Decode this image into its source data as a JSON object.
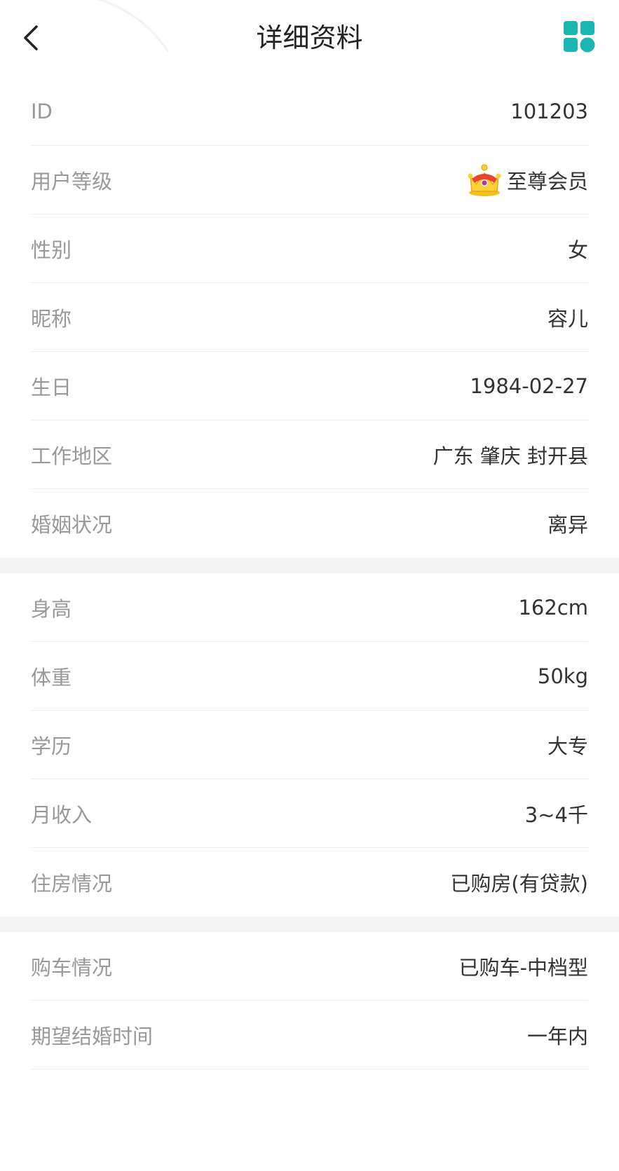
{
  "header": {
    "title": "详细资料",
    "back_icon": "chevron-left-icon",
    "menu_icon": "grid-icon",
    "accent_color": "#1ab7b2"
  },
  "section1": [
    {
      "label": "ID",
      "value": "101203"
    },
    {
      "label": "用户等级",
      "value": "至尊会员",
      "icon": "crown-icon"
    },
    {
      "label": "性别",
      "value": "女"
    },
    {
      "label": "昵称",
      "value": "容儿"
    },
    {
      "label": "生日",
      "value": "1984-02-27"
    },
    {
      "label": "工作地区",
      "value": "广东 肇庆 封开县"
    },
    {
      "label": "婚姻状况",
      "value": "离异"
    }
  ],
  "section2": [
    {
      "label": "身高",
      "value": "162cm"
    },
    {
      "label": "体重",
      "value": "50kg"
    },
    {
      "label": "学历",
      "value": "大专"
    },
    {
      "label": "月收入",
      "value": "3~4千"
    },
    {
      "label": "住房情况",
      "value": "已购房(有贷款)"
    }
  ],
  "section3": [
    {
      "label": "购车情况",
      "value": "已购车-中档型"
    },
    {
      "label": "期望结婚时间",
      "value": "一年内"
    }
  ]
}
